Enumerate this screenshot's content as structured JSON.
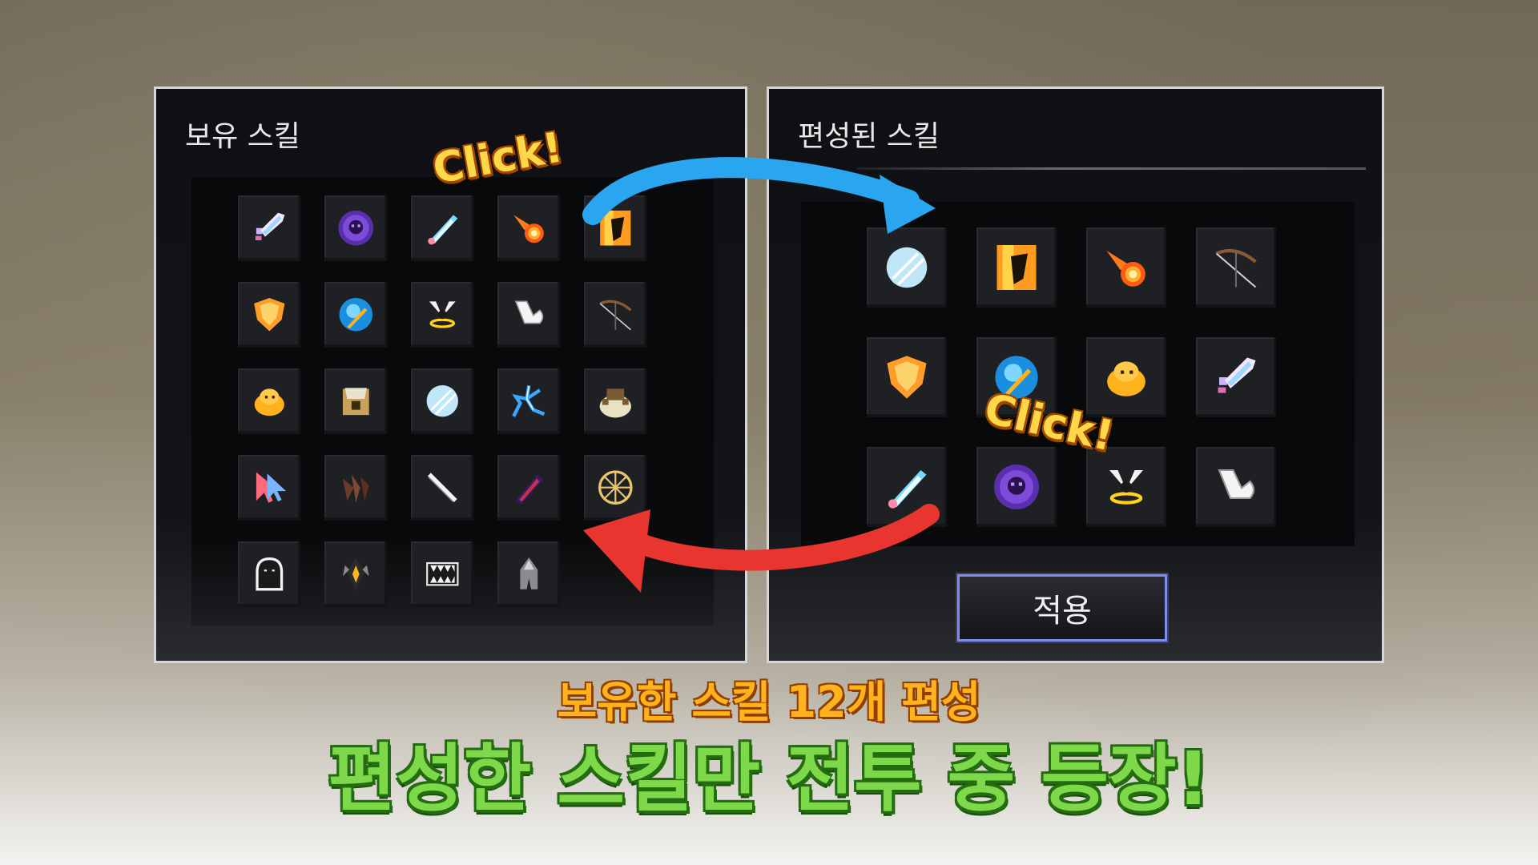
{
  "owned_panel": {
    "title": "보유 스킬",
    "icons": [
      "pixel-sword-icon",
      "purple-skull-orb-icon",
      "ice-shard-icon",
      "fireball-icon",
      "fire-pillar-icon",
      "golden-shield-icon",
      "blue-orb-sword-icon",
      "winged-halo-icon",
      "flexed-arm-icon",
      "crossbow-icon",
      "golden-blob-icon",
      "armored-beast-icon",
      "ice-disc-icon",
      "lightning-figure-icon",
      "rock-beast-icon",
      "arrow-cursor-icon",
      "brown-claw-icon",
      "white-line-icon",
      "dark-crystal-icon",
      "golden-wheel-icon",
      "ghost-outline-icon",
      "dark-fang-icon",
      "teeth-jaw-icon",
      "hooded-figure-icon"
    ]
  },
  "formed_panel": {
    "title": "편성된 스킬",
    "icons": [
      "ice-disc-icon",
      "fire-pillar-icon",
      "fireball-icon",
      "crossbow-icon",
      "golden-shield-icon",
      "blue-orb-sword-icon",
      "golden-blob-icon",
      "pixel-sword-icon",
      "ice-shard-icon",
      "purple-skull-orb-icon",
      "winged-halo-icon",
      "flexed-arm-icon"
    ],
    "apply_label": "적용"
  },
  "annotations": {
    "click_top": "Click!",
    "click_mid": "Click!"
  },
  "captions": {
    "sub": "보유한 스킬 12개 편성",
    "main": "편성한 스킬만 전투 중 등장!"
  },
  "colors": {
    "arrow_blue": "#2aa6f0",
    "arrow_red": "#e8352f",
    "apply_border": "#7d8ee8"
  }
}
